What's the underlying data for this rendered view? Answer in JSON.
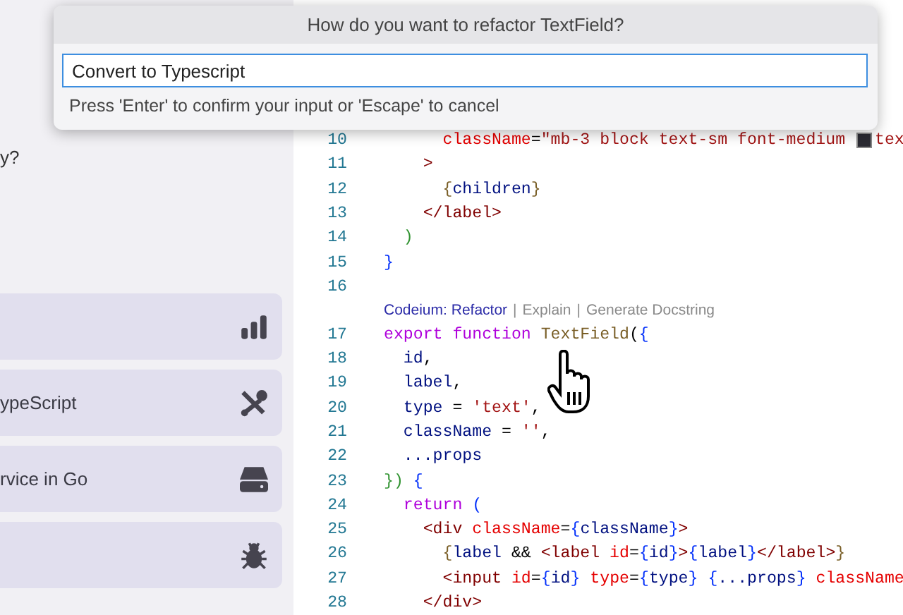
{
  "side_panel": {
    "question": "y?",
    "cards": [
      {
        "kind": "chart"
      },
      {
        "label": "ypeScript",
        "kind": "tools"
      },
      {
        "label": "rvice in Go",
        "kind": "drive"
      },
      {
        "kind": "bug"
      }
    ]
  },
  "editor": {
    "lines": [
      {
        "kind": "code",
        "number": "10",
        "tokens": [
          {
            "text": "      className",
            "kind": "attr"
          },
          {
            "text": "=",
            "kind": "punct"
          },
          {
            "text": "\"mb-3 block text-sm font-medium ",
            "kind": "str"
          },
          {
            "kind": "swatch",
            "color": "#2b2b33"
          },
          {
            "text": "tex",
            "kind": "str"
          }
        ]
      },
      {
        "kind": "code",
        "number": "11",
        "tokens": [
          {
            "text": "    >",
            "kind": "tag"
          }
        ]
      },
      {
        "kind": "code",
        "number": "12",
        "tokens": [
          {
            "text": "      {",
            "kind": "brace"
          },
          {
            "text": "children",
            "kind": "var"
          },
          {
            "text": "}",
            "kind": "brace"
          }
        ]
      },
      {
        "kind": "code",
        "number": "13",
        "tokens": [
          {
            "text": "    </",
            "kind": "tag"
          },
          {
            "text": "label",
            "kind": "tag"
          },
          {
            "text": ">",
            "kind": "tag"
          }
        ]
      },
      {
        "kind": "code",
        "number": "14",
        "tokens": [
          {
            "text": "  )",
            "kind": "paren"
          }
        ]
      },
      {
        "kind": "code",
        "number": "15",
        "tokens": [
          {
            "text": "}",
            "kind": "brace2"
          }
        ]
      },
      {
        "kind": "code",
        "number": "16"
      },
      {
        "kind": "lens",
        "separator": "|",
        "actions": [
          {
            "label": "Codeium: Refactor",
            "hovered": true
          },
          {
            "label": "Explain",
            "hovered": false
          },
          {
            "label": "Generate Docstring",
            "hovered": false
          }
        ]
      },
      {
        "kind": "code",
        "number": "17",
        "tokens": [
          {
            "text": "export function",
            "kind": "kw"
          },
          {
            "text": " TextField",
            "kind": "fn"
          },
          {
            "text": "(",
            "kind": "punct"
          },
          {
            "text": "{",
            "kind": "brace2"
          }
        ]
      },
      {
        "kind": "code",
        "number": "18",
        "tokens": [
          {
            "text": "  id",
            "kind": "var"
          },
          {
            "text": ",",
            "kind": "punct"
          }
        ]
      },
      {
        "kind": "code",
        "number": "19",
        "tokens": [
          {
            "text": "  label",
            "kind": "var"
          },
          {
            "text": ",",
            "kind": "punct"
          }
        ]
      },
      {
        "kind": "code",
        "number": "20",
        "tokens": [
          {
            "text": "  type",
            "kind": "var"
          },
          {
            "text": " = ",
            "kind": "punct"
          },
          {
            "text": "'text'",
            "kind": "str"
          },
          {
            "text": ",",
            "kind": "punct"
          }
        ]
      },
      {
        "kind": "code",
        "number": "21",
        "tokens": [
          {
            "text": "  className",
            "kind": "var"
          },
          {
            "text": " = ",
            "kind": "punct"
          },
          {
            "text": "''",
            "kind": "str"
          },
          {
            "text": ",",
            "kind": "punct"
          }
        ]
      },
      {
        "kind": "code",
        "number": "22",
        "tokens": [
          {
            "text": "  ...props",
            "kind": "var"
          }
        ]
      },
      {
        "kind": "code",
        "number": "23",
        "tokens": [
          {
            "text": "})",
            "kind": "paren"
          },
          {
            "text": " {",
            "kind": "brace2"
          }
        ]
      },
      {
        "kind": "code",
        "number": "24",
        "tokens": [
          {
            "text": "  return",
            "kind": "kw"
          },
          {
            "text": " (",
            "kind": "brace2"
          }
        ]
      },
      {
        "kind": "code",
        "number": "25",
        "tokens": [
          {
            "text": "    <div",
            "kind": "tag"
          },
          {
            "text": " className",
            "kind": "attr"
          },
          {
            "text": "=",
            "kind": "punct"
          },
          {
            "text": "{",
            "kind": "brace2"
          },
          {
            "text": "className",
            "kind": "var"
          },
          {
            "text": "}",
            "kind": "brace2"
          },
          {
            "text": ">",
            "kind": "tag"
          }
        ]
      },
      {
        "kind": "code",
        "number": "26",
        "tokens": [
          {
            "text": "      {",
            "kind": "brace"
          },
          {
            "text": "label",
            "kind": "var"
          },
          {
            "text": " && ",
            "kind": "punct"
          },
          {
            "text": "<label",
            "kind": "tag"
          },
          {
            "text": " id",
            "kind": "attr"
          },
          {
            "text": "=",
            "kind": "punct"
          },
          {
            "text": "{",
            "kind": "brace2"
          },
          {
            "text": "id",
            "kind": "var"
          },
          {
            "text": "}",
            "kind": "brace2"
          },
          {
            "text": ">",
            "kind": "tag"
          },
          {
            "text": "{",
            "kind": "brace2"
          },
          {
            "text": "label",
            "kind": "var"
          },
          {
            "text": "}",
            "kind": "brace2"
          },
          {
            "text": "</label>",
            "kind": "tag"
          },
          {
            "text": "}",
            "kind": "brace"
          }
        ]
      },
      {
        "kind": "code",
        "number": "27",
        "tokens": [
          {
            "text": "      <input",
            "kind": "tag"
          },
          {
            "text": " id",
            "kind": "attr"
          },
          {
            "text": "=",
            "kind": "punct"
          },
          {
            "text": "{",
            "kind": "brace2"
          },
          {
            "text": "id",
            "kind": "var"
          },
          {
            "text": "}",
            "kind": "brace2"
          },
          {
            "text": " type",
            "kind": "attr"
          },
          {
            "text": "=",
            "kind": "punct"
          },
          {
            "text": "{",
            "kind": "brace2"
          },
          {
            "text": "type",
            "kind": "var"
          },
          {
            "text": "}",
            "kind": "brace2"
          },
          {
            "text": " {",
            "kind": "brace2"
          },
          {
            "text": "...props",
            "kind": "var"
          },
          {
            "text": "}",
            "kind": "brace2"
          },
          {
            "text": " className",
            "kind": "attr"
          }
        ]
      },
      {
        "kind": "code",
        "number": "28",
        "tokens": [
          {
            "text": "    </div>",
            "kind": "tag"
          }
        ]
      }
    ]
  },
  "dialog": {
    "title": "How do you want to refactor TextField?",
    "input": {
      "value": "Convert to Typescript"
    },
    "hint": "Press 'Enter' to confirm your input or 'Escape' to cancel"
  }
}
